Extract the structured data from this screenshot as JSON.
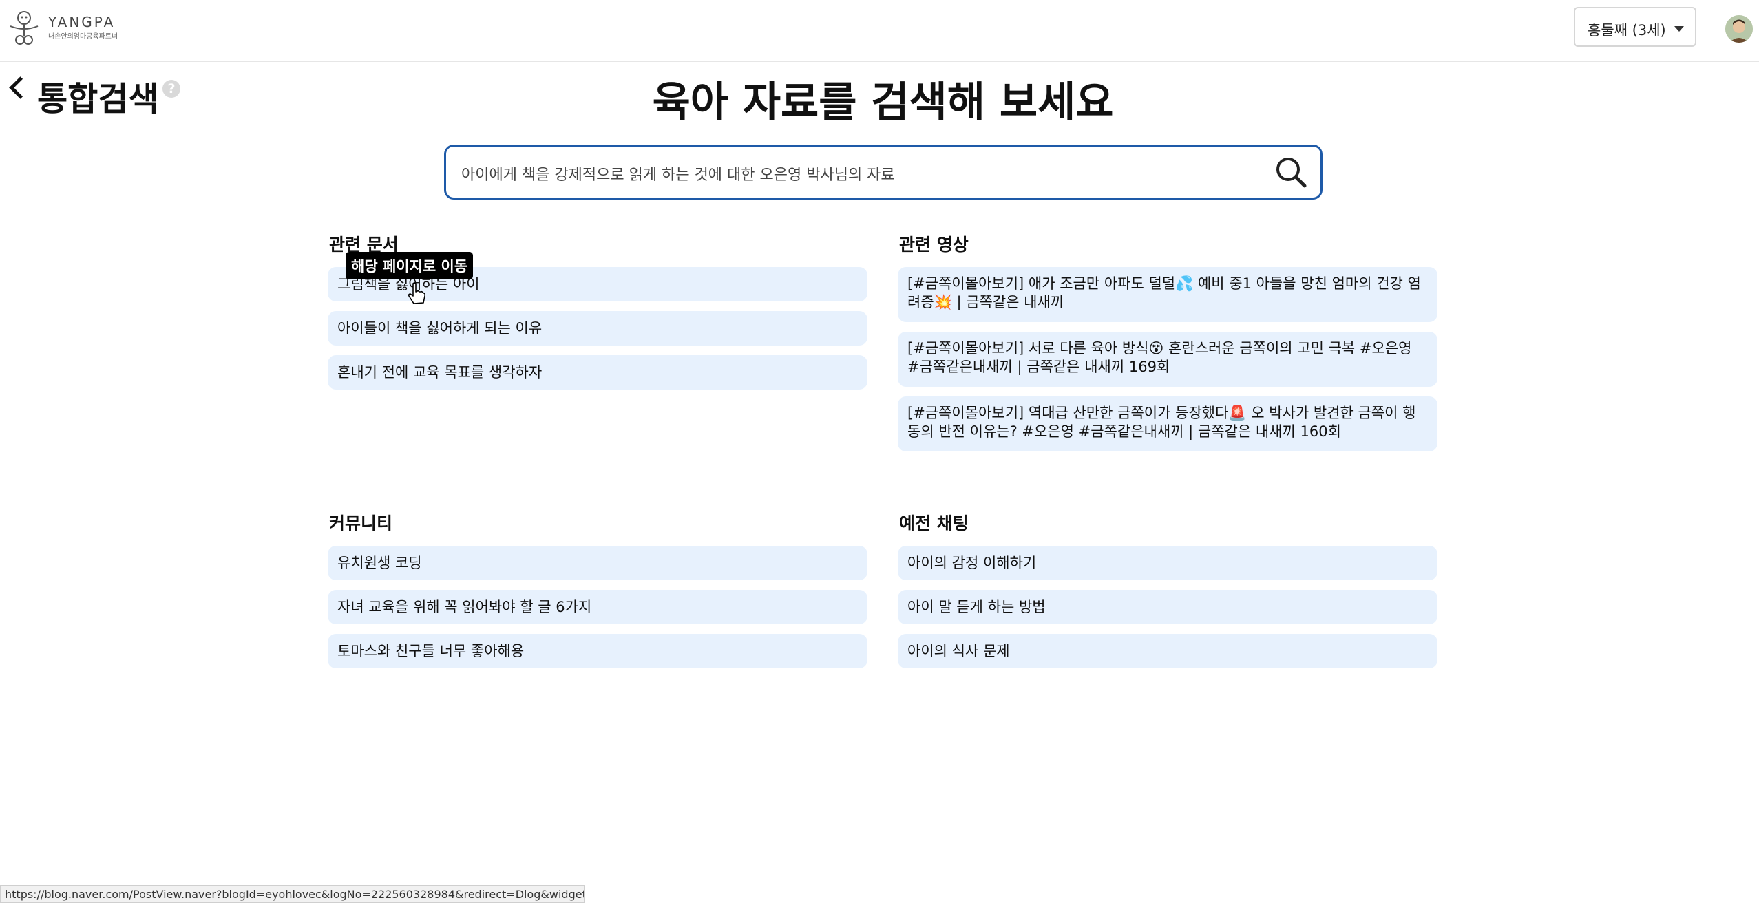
{
  "header": {
    "logo_name": "YANGPA",
    "logo_sub": "내손안의엄마공육파트너",
    "child_select_value": "홍둘째 (3세)"
  },
  "page": {
    "back_title": "통합검색",
    "help_label": "?",
    "main_title": "육아 자료를 검색해 보세요"
  },
  "search": {
    "value": "아이에게 책을 강제적으로 읽게 하는 것에 대한 오은영 박사님의 자료",
    "placeholder": ""
  },
  "sections": {
    "docs": {
      "title": "관련 문서",
      "items": [
        "그림책을 싫어하는 아이",
        "아이들이 책을 싫어하게 되는 이유",
        "혼내기 전에 교육 목표를 생각하자"
      ]
    },
    "videos": {
      "title": "관련 영상",
      "items": [
        "[#금쪽이몰아보기] 애가 조금만 아파도 덜덜💦 예비 중1 아들을 망친 엄마의 건강 염려증💥 | 금쪽같은 내새끼",
        "[#금쪽이몰아보기] 서로 다른 육아 방식😵 혼란스러운 금쪽이의 고민 극복 #오은영 #금쪽같은내새끼 | 금쪽같은 내새끼 169회",
        "[#금쪽이몰아보기] 역대급 산만한 금쪽이가 등장했다🚨 오 박사가 발견한 금쪽이 행동의 반전 이유는? #오은영 #금쪽같은내새끼 | 금쪽같은 내새끼 160회"
      ]
    },
    "community": {
      "title": "커뮤니티",
      "items": [
        "유치원생 코딩",
        "자녀 교육을 위해 꼭 읽어봐야 할 글 6가지",
        "토마스와 친구들 너무 좋아해용"
      ]
    },
    "chats": {
      "title": "예전 채팅",
      "items": [
        "아이의 감정 이해하기",
        "아이 말 듣게 하는 방법",
        "아이의 식사 문제"
      ]
    }
  },
  "tooltip": "해당 페이지로 이동",
  "status_url": "https://blog.naver.com/PostView.naver?blogId=eyohlovec&logNo=222560328984&redirect=Dlog&widgetTypeCal...",
  "colors": {
    "accent": "#1e5aa8",
    "item_bg": "#e7f1fd"
  }
}
